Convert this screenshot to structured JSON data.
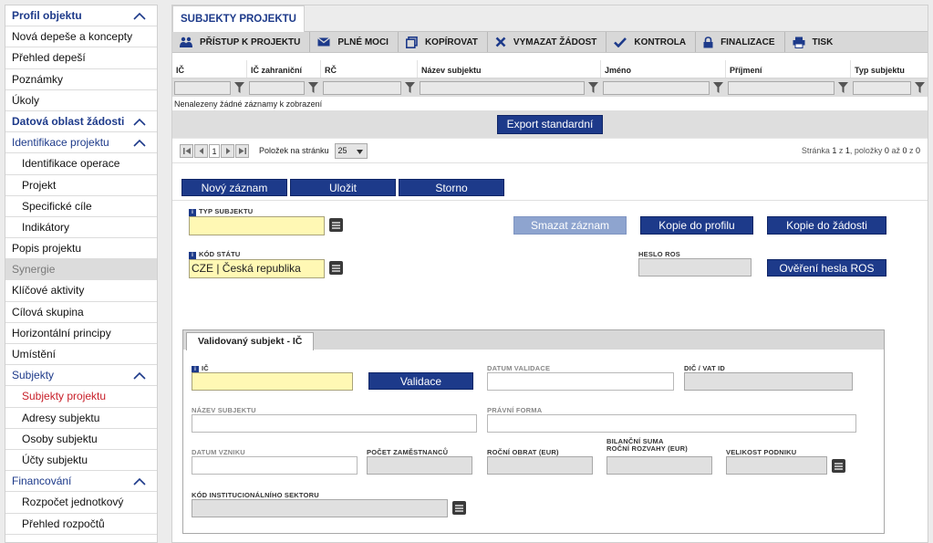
{
  "sidebar": {
    "items": [
      {
        "label": "Profil objektu",
        "kind": "header"
      },
      {
        "label": "Nová depeše a koncepty",
        "kind": "item"
      },
      {
        "label": "Přehled depeší",
        "kind": "item"
      },
      {
        "label": "Poznámky",
        "kind": "item"
      },
      {
        "label": "Úkoly",
        "kind": "item"
      },
      {
        "label": "Datová oblast žádosti",
        "kind": "header"
      },
      {
        "label": "Identifikace projektu",
        "kind": "group"
      },
      {
        "label": "Identifikace operace",
        "kind": "sub"
      },
      {
        "label": "Projekt",
        "kind": "sub"
      },
      {
        "label": "Specifické cíle",
        "kind": "sub"
      },
      {
        "label": "Indikátory",
        "kind": "sub"
      },
      {
        "label": "Popis projektu",
        "kind": "item"
      },
      {
        "label": "Synergie",
        "kind": "disabled"
      },
      {
        "label": "Klíčové aktivity",
        "kind": "item"
      },
      {
        "label": "Cílová skupina",
        "kind": "item"
      },
      {
        "label": "Horizontální principy",
        "kind": "item"
      },
      {
        "label": "Umístění",
        "kind": "item"
      },
      {
        "label": "Subjekty",
        "kind": "group"
      },
      {
        "label": "Subjekty projektu",
        "kind": "sub-active"
      },
      {
        "label": "Adresy subjektu",
        "kind": "sub"
      },
      {
        "label": "Osoby subjektu",
        "kind": "sub"
      },
      {
        "label": "Účty subjektu",
        "kind": "sub"
      },
      {
        "label": "Financování",
        "kind": "group"
      },
      {
        "label": "Rozpočet jednotkový",
        "kind": "sub"
      },
      {
        "label": "Přehled rozpočtů",
        "kind": "sub"
      }
    ]
  },
  "main": {
    "tab_title": "SUBJEKTY PROJEKTU",
    "toolbar": {
      "access": "PŘÍSTUP K PROJEKTU",
      "power": "PLNÉ MOCI",
      "copy": "KOPÍROVAT",
      "clear": "VYMAZAT ŽÁDOST",
      "check": "KONTROLA",
      "finalize": "FINALIZACE",
      "print": "TISK"
    },
    "grid": {
      "columns": [
        "IČ",
        "IČ zahraniční",
        "RČ",
        "Název subjektu",
        "Jméno",
        "Příjmení",
        "Typ subjektu"
      ],
      "empty_message": "Nenalezeny žádné záznamy k zobrazení",
      "export_label": "Export standardní"
    },
    "pager": {
      "current_page": "1",
      "per_page_label": "Položek na stránku",
      "per_page_value": "25",
      "info_prefix": "Stránka ",
      "page": "1",
      "of": " z ",
      "total_pages": "1",
      "items_label": ", položky ",
      "from": "0",
      "to_label": " až ",
      "to": "0",
      "count_label": " z ",
      "count": "0"
    },
    "actions": {
      "new": "Nový záznam",
      "save": "Uložit",
      "cancel": "Storno",
      "delete": "Smazat záznam",
      "copy_profile": "Kopie do profilu",
      "copy_request": "Kopie do žádosti",
      "verify_ros": "Ověření hesla ROS"
    },
    "form": {
      "type_label": "TYP SUBJEKTU",
      "type_value": "",
      "country_label": "KÓD STÁTU",
      "country_value": "CZE | Česká republika",
      "ros_label": "HESLO ROS",
      "ros_value": ""
    },
    "subpanel": {
      "tab_label": "Validovaný subjekt - IČ",
      "ic_label": "IČ",
      "ic_value": "",
      "validate_label": "Validace",
      "validation_date_label": "DATUM VALIDACE",
      "dic_label": "DIČ / VAT ID",
      "name_label": "NÁZEV SUBJEKTU",
      "legal_form_label": "PRÁVNÍ FORMA",
      "founding_date_label": "DATUM VZNIKU",
      "employees_label": "POČET ZAMĚSTNANCŮ",
      "turnover_label": "ROČNÍ OBRAT (EUR)",
      "balance_label_1": "BILANČNÍ SUMA",
      "balance_label_2": "ROČNÍ ROZVAHY (EUR)",
      "company_size_label": "VELIKOST PODNIKU",
      "sector_code_label": "KÓD INSTITUCIONÁLNÍHO SEKTORU"
    }
  },
  "colors": {
    "accent_blue": "#1d3a8a",
    "active_red": "#c8202a",
    "required_yellow": "#fff8b4",
    "disabled_blue": "#8ea4cf"
  }
}
